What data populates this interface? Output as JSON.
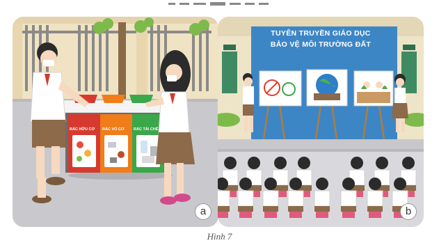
{
  "figure": {
    "caption": "Hình 7"
  },
  "panel_a": {
    "badge": "a",
    "bins": [
      {
        "label": "RÁC HỮU CƠ",
        "color": "#d63a2e"
      },
      {
        "label": "RÁC VÔ CƠ",
        "color": "#f07d1a"
      },
      {
        "label": "RÁC TÁI CHẾ",
        "color": "#3aa84a"
      }
    ]
  },
  "panel_b": {
    "badge": "b",
    "banner_line1": "TUYÊN TRUYỀN GIÁO DỤC",
    "banner_line2": "BẢO VỆ MÔI TRƯỜNG ĐẤT",
    "banner_color": "#3d86c6"
  }
}
